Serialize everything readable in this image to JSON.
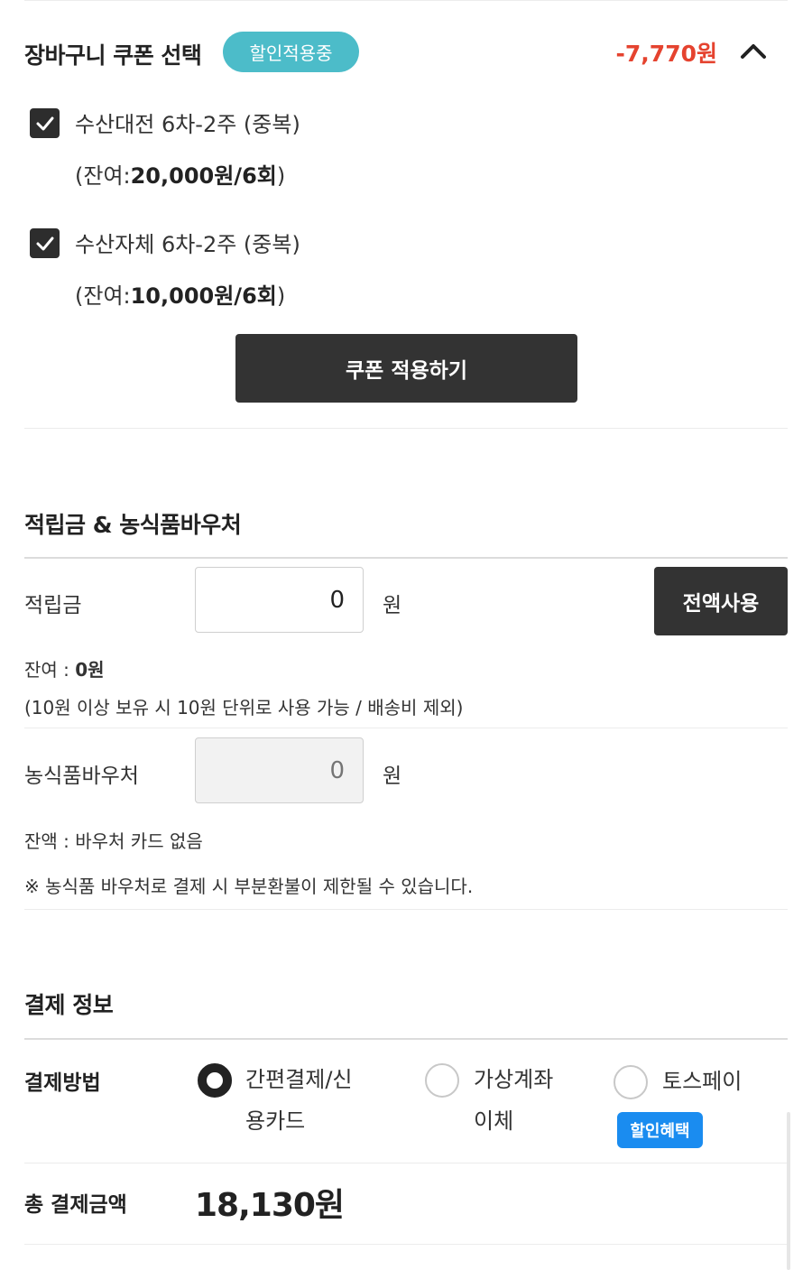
{
  "coupon": {
    "title": "장바구니 쿠폰 선택",
    "badge": "할인적용중",
    "discount": "-7,770원",
    "items": [
      {
        "name": "수산대전 6차-2주 (중복)",
        "balance_prefix": "(잔여:",
        "balance_value": "20,000원/6회",
        "balance_suffix": ")",
        "checked": true
      },
      {
        "name": "수산자체 6차-2주 (중복)",
        "balance_prefix": "(잔여:",
        "balance_value": "10,000원/6회",
        "balance_suffix": ")",
        "checked": true
      }
    ],
    "apply_label": "쿠폰 적용하기"
  },
  "points": {
    "title": "적립금 & 농식품바우처",
    "points_label": "적립금",
    "points_value": "0",
    "unit": "원",
    "use_all_label": "전액사용",
    "balance_prefix": "잔여 : ",
    "balance_value": "0원",
    "note": "(10원 이상 보유 시 10원 단위로 사용 가능 / 배송비 제외)",
    "voucher_label": "농식품바우처",
    "voucher_placeholder": "0",
    "voucher_balance": "잔액 : 바우처 카드 없음",
    "voucher_note": "※ 농식품 바우처로 결제 시 부분환불이 제한될 수 있습니다."
  },
  "payment": {
    "title": "결제 정보",
    "method_label": "결제방법",
    "options": [
      {
        "line1": "간편결제/신",
        "line2": "용카드",
        "selected": true
      },
      {
        "line1": "가상계좌",
        "line2": "이체",
        "selected": false
      },
      {
        "line1": "토스페이",
        "line2": "",
        "selected": false
      }
    ],
    "toss_badge": "할인혜택",
    "total_label": "총 결제금액",
    "total_value": "18,130원"
  },
  "colors": {
    "accent_teal": "#4cbcc9",
    "discount_red": "#e5432f",
    "button_dark": "#333333",
    "badge_blue": "#1a8cf0"
  }
}
